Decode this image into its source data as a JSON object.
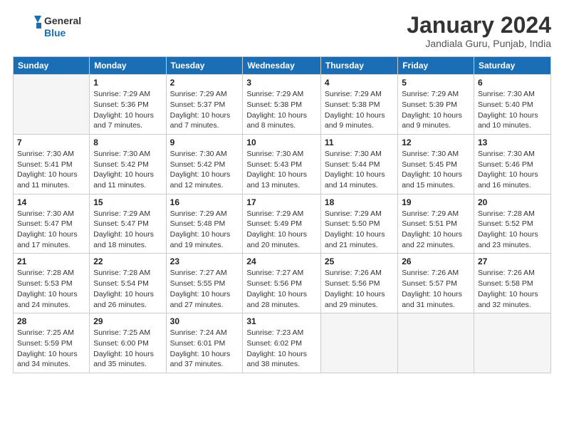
{
  "header": {
    "logo_general": "General",
    "logo_blue": "Blue",
    "month_title": "January 2024",
    "location": "Jandiala Guru, Punjab, India"
  },
  "days_of_week": [
    "Sunday",
    "Monday",
    "Tuesday",
    "Wednesday",
    "Thursday",
    "Friday",
    "Saturday"
  ],
  "weeks": [
    [
      {
        "day": "",
        "info": ""
      },
      {
        "day": "1",
        "info": "Sunrise: 7:29 AM\nSunset: 5:36 PM\nDaylight: 10 hours\nand 7 minutes."
      },
      {
        "day": "2",
        "info": "Sunrise: 7:29 AM\nSunset: 5:37 PM\nDaylight: 10 hours\nand 7 minutes."
      },
      {
        "day": "3",
        "info": "Sunrise: 7:29 AM\nSunset: 5:38 PM\nDaylight: 10 hours\nand 8 minutes."
      },
      {
        "day": "4",
        "info": "Sunrise: 7:29 AM\nSunset: 5:38 PM\nDaylight: 10 hours\nand 9 minutes."
      },
      {
        "day": "5",
        "info": "Sunrise: 7:29 AM\nSunset: 5:39 PM\nDaylight: 10 hours\nand 9 minutes."
      },
      {
        "day": "6",
        "info": "Sunrise: 7:30 AM\nSunset: 5:40 PM\nDaylight: 10 hours\nand 10 minutes."
      }
    ],
    [
      {
        "day": "7",
        "info": "Sunrise: 7:30 AM\nSunset: 5:41 PM\nDaylight: 10 hours\nand 11 minutes."
      },
      {
        "day": "8",
        "info": "Sunrise: 7:30 AM\nSunset: 5:42 PM\nDaylight: 10 hours\nand 11 minutes."
      },
      {
        "day": "9",
        "info": "Sunrise: 7:30 AM\nSunset: 5:42 PM\nDaylight: 10 hours\nand 12 minutes."
      },
      {
        "day": "10",
        "info": "Sunrise: 7:30 AM\nSunset: 5:43 PM\nDaylight: 10 hours\nand 13 minutes."
      },
      {
        "day": "11",
        "info": "Sunrise: 7:30 AM\nSunset: 5:44 PM\nDaylight: 10 hours\nand 14 minutes."
      },
      {
        "day": "12",
        "info": "Sunrise: 7:30 AM\nSunset: 5:45 PM\nDaylight: 10 hours\nand 15 minutes."
      },
      {
        "day": "13",
        "info": "Sunrise: 7:30 AM\nSunset: 5:46 PM\nDaylight: 10 hours\nand 16 minutes."
      }
    ],
    [
      {
        "day": "14",
        "info": "Sunrise: 7:30 AM\nSunset: 5:47 PM\nDaylight: 10 hours\nand 17 minutes."
      },
      {
        "day": "15",
        "info": "Sunrise: 7:29 AM\nSunset: 5:47 PM\nDaylight: 10 hours\nand 18 minutes."
      },
      {
        "day": "16",
        "info": "Sunrise: 7:29 AM\nSunset: 5:48 PM\nDaylight: 10 hours\nand 19 minutes."
      },
      {
        "day": "17",
        "info": "Sunrise: 7:29 AM\nSunset: 5:49 PM\nDaylight: 10 hours\nand 20 minutes."
      },
      {
        "day": "18",
        "info": "Sunrise: 7:29 AM\nSunset: 5:50 PM\nDaylight: 10 hours\nand 21 minutes."
      },
      {
        "day": "19",
        "info": "Sunrise: 7:29 AM\nSunset: 5:51 PM\nDaylight: 10 hours\nand 22 minutes."
      },
      {
        "day": "20",
        "info": "Sunrise: 7:28 AM\nSunset: 5:52 PM\nDaylight: 10 hours\nand 23 minutes."
      }
    ],
    [
      {
        "day": "21",
        "info": "Sunrise: 7:28 AM\nSunset: 5:53 PM\nDaylight: 10 hours\nand 24 minutes."
      },
      {
        "day": "22",
        "info": "Sunrise: 7:28 AM\nSunset: 5:54 PM\nDaylight: 10 hours\nand 26 minutes."
      },
      {
        "day": "23",
        "info": "Sunrise: 7:27 AM\nSunset: 5:55 PM\nDaylight: 10 hours\nand 27 minutes."
      },
      {
        "day": "24",
        "info": "Sunrise: 7:27 AM\nSunset: 5:56 PM\nDaylight: 10 hours\nand 28 minutes."
      },
      {
        "day": "25",
        "info": "Sunrise: 7:26 AM\nSunset: 5:56 PM\nDaylight: 10 hours\nand 29 minutes."
      },
      {
        "day": "26",
        "info": "Sunrise: 7:26 AM\nSunset: 5:57 PM\nDaylight: 10 hours\nand 31 minutes."
      },
      {
        "day": "27",
        "info": "Sunrise: 7:26 AM\nSunset: 5:58 PM\nDaylight: 10 hours\nand 32 minutes."
      }
    ],
    [
      {
        "day": "28",
        "info": "Sunrise: 7:25 AM\nSunset: 5:59 PM\nDaylight: 10 hours\nand 34 minutes."
      },
      {
        "day": "29",
        "info": "Sunrise: 7:25 AM\nSunset: 6:00 PM\nDaylight: 10 hours\nand 35 minutes."
      },
      {
        "day": "30",
        "info": "Sunrise: 7:24 AM\nSunset: 6:01 PM\nDaylight: 10 hours\nand 37 minutes."
      },
      {
        "day": "31",
        "info": "Sunrise: 7:23 AM\nSunset: 6:02 PM\nDaylight: 10 hours\nand 38 minutes."
      },
      {
        "day": "",
        "info": ""
      },
      {
        "day": "",
        "info": ""
      },
      {
        "day": "",
        "info": ""
      }
    ]
  ]
}
